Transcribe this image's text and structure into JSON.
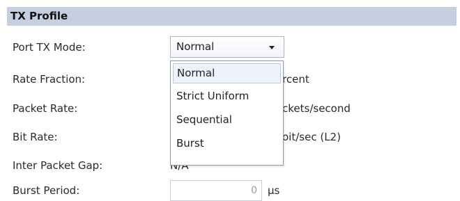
{
  "section": {
    "title": "TX Profile"
  },
  "rows": {
    "port_tx_mode": {
      "label": "Port TX Mode:"
    },
    "rate_fraction": {
      "label": "Rate Fraction:",
      "unit_visible": "rcent"
    },
    "packet_rate": {
      "label": "Packet Rate:",
      "unit_visible": "ckets/second"
    },
    "bit_rate": {
      "label": "Bit Rate:",
      "unit_visible": "oit/sec (L2)"
    },
    "inter_packet_gap": {
      "label": "Inter Packet Gap:",
      "value": "N/A"
    },
    "burst_period": {
      "label": "Burst Period:",
      "value": "0",
      "unit": "µs"
    }
  },
  "tx_mode_select": {
    "selected": "Normal",
    "options": [
      "Normal",
      "Strict Uniform",
      "Sequential",
      "Burst"
    ],
    "highlighted_index": 0
  },
  "colors": {
    "header_bg": "#c5cfdf",
    "option_highlight": "#eef3fb"
  },
  "icons": {
    "dropdown_arrow": "chevron-down-icon"
  }
}
